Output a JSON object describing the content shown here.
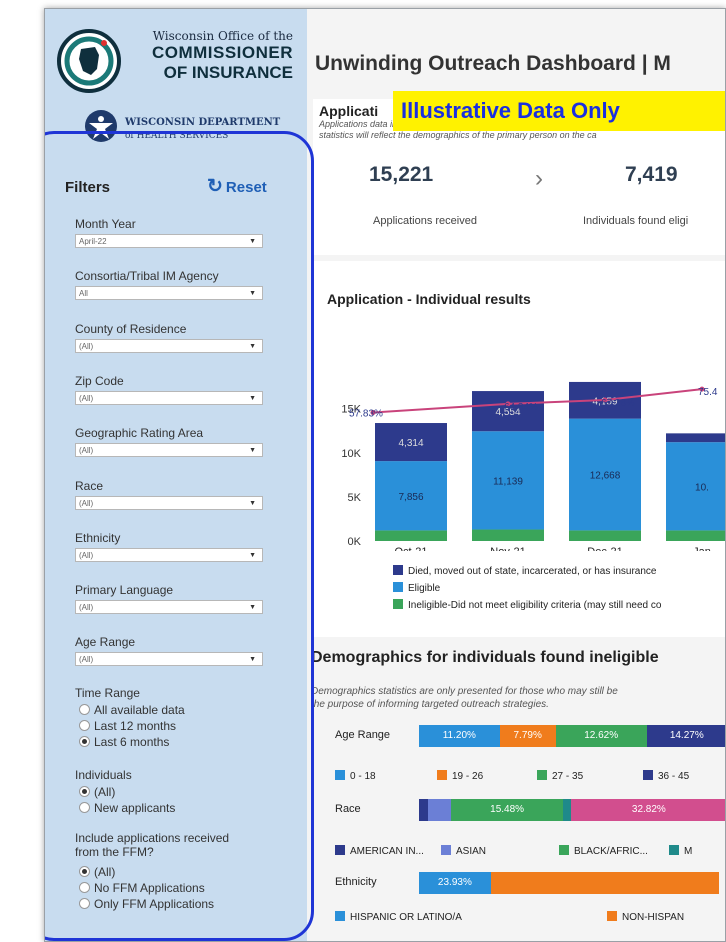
{
  "header": {
    "oci_line1": "Wisconsin Office of the",
    "oci_line2": "COMMISSIONER",
    "oci_line3": "OF INSURANCE",
    "dhs_line1": "WISCONSIN DEPARTMENT",
    "dhs_line2": "of HEALTH SERVICES",
    "title": "Unwinding Outreach Dashboard | M",
    "banner": "Illustrative Data Only"
  },
  "filters": {
    "heading": "Filters",
    "reset_label": "Reset",
    "reset_icon": "refresh-icon",
    "dropdowns": [
      {
        "label": "Month Year",
        "value": "April-22"
      },
      {
        "label": "Consortia/Tribal IM Agency",
        "value": "All"
      },
      {
        "label": "County of Residence",
        "value": "(All)"
      },
      {
        "label": "Zip Code",
        "value": "(All)"
      },
      {
        "label": "Geographic Rating Area",
        "value": "(All)"
      },
      {
        "label": "Race",
        "value": "(All)"
      },
      {
        "label": "Ethnicity",
        "value": "(All)"
      },
      {
        "label": "Primary Language",
        "value": "(All)"
      },
      {
        "label": "Age Range",
        "value": "(All)"
      }
    ],
    "time_range": {
      "label": "Time Range",
      "options": [
        "All available data",
        "Last 12 months",
        "Last 6 months"
      ],
      "selected": "Last 6 months"
    },
    "individuals": {
      "label": "Individuals",
      "options": [
        "(All)",
        "New applicants"
      ],
      "selected": "(All)"
    },
    "ffm": {
      "label_line1": "Include applications received",
      "label_line2": "from the FFM?",
      "options": [
        "(All)",
        "No FFM Applications",
        "Only FFM Applications"
      ],
      "selected": "(All)"
    }
  },
  "kpi": {
    "heading": "Applicati",
    "desc_line1": "Applications data includes both new applications and (re)applications",
    "desc_line2": "statistics will reflect the demographics of the primary person on the ca",
    "applications_value": "15,221",
    "applications_label": "Applications received",
    "arrow": "›",
    "eligible_value": "7,419",
    "eligible_label": "Individuals found eligi"
  },
  "chart_data": {
    "type": "bar",
    "title": "Application - Individual results",
    "categories": [
      "Oct-21",
      "Nov-21",
      "Dec-21",
      "Jan"
    ],
    "yticks": [
      "0K",
      "5K",
      "10K",
      "15K"
    ],
    "ylim": [
      0,
      17000
    ],
    "series": [
      {
        "name": "Ineligible-Did not meet eligibility criteria (may still need co",
        "color": "#3aa55a",
        "values": [
          1200,
          1300,
          1200,
          1200
        ]
      },
      {
        "name": "Eligible",
        "color": "#2a90d9",
        "values": [
          7856,
          11139,
          12668,
          10000
        ]
      },
      {
        "name": "Died, moved out of state, incarcerated, or has insurance",
        "color": "#2d3a8c",
        "values": [
          4314,
          4554,
          4159,
          1000
        ]
      }
    ],
    "data_labels": {
      "ineligible": [
        "",
        "",
        "",
        ""
      ],
      "eligible": [
        "7,856",
        "11,139",
        "12,668",
        "10."
      ],
      "died": [
        "4,314",
        "4,554",
        "4,159",
        ""
      ]
    },
    "line": {
      "values": [
        57.83,
        64.34,
        67.28,
        75.4
      ],
      "labels": [
        "57.83%",
        "64.34%",
        "67.28%",
        "75.4"
      ],
      "color": "#c9437b",
      "range": [
        50,
        80
      ]
    }
  },
  "demographics": {
    "title": "Demographics for individuals found ineligible",
    "desc_line1": "Demographics statistics are only presented for those who may still be",
    "desc_line2": "the purpose of informing targeted outreach strategies.",
    "age": {
      "label": "Age Range",
      "segments": [
        {
          "label": "11.20%",
          "pct": 11.2,
          "color": "#2a90d9"
        },
        {
          "label": "7.79%",
          "pct": 7.79,
          "color": "#f07c1c"
        },
        {
          "label": "12.62%",
          "pct": 12.62,
          "color": "#3aa55a"
        },
        {
          "label": "14.27%",
          "pct": 14.27,
          "color": "#2d3a8c"
        }
      ],
      "legend": [
        {
          "label": "0 - 18",
          "color": "#2a90d9"
        },
        {
          "label": "19 - 26",
          "color": "#f07c1c"
        },
        {
          "label": "27 - 35",
          "color": "#3aa55a"
        },
        {
          "label": "36 - 45",
          "color": "#2d3a8c"
        }
      ]
    },
    "race": {
      "label": "Race",
      "segments": [
        {
          "label": "",
          "pct": 1.2,
          "color": "#2d3a8c"
        },
        {
          "label": "",
          "pct": 3.3,
          "color": "#6b7fd6"
        },
        {
          "label": "15.48%",
          "pct": 15.48,
          "color": "#3aa55a"
        },
        {
          "label": "",
          "pct": 1.1,
          "color": "#1f8a8a"
        },
        {
          "label": "32.82%",
          "pct": 32.82,
          "color": "#d24e8e"
        }
      ],
      "legend": [
        {
          "label": "AMERICAN IN...",
          "color": "#2d3a8c"
        },
        {
          "label": "ASIAN",
          "color": "#6b7fd6"
        },
        {
          "label": "BLACK/AFRIC...",
          "color": "#3aa55a"
        },
        {
          "label": "M",
          "color": "#1f8a8a"
        }
      ]
    },
    "ethnicity": {
      "label": "Ethnicity",
      "segments": [
        {
          "label": "23.93%",
          "pct": 23.93,
          "color": "#2a90d9"
        },
        {
          "label": "",
          "pct": 76.07,
          "color": "#f07c1c"
        }
      ],
      "legend": [
        {
          "label": "HISPANIC OR LATINO/A",
          "color": "#2a90d9"
        },
        {
          "label": "NON-HISPAN",
          "color": "#f07c1c"
        }
      ]
    }
  }
}
